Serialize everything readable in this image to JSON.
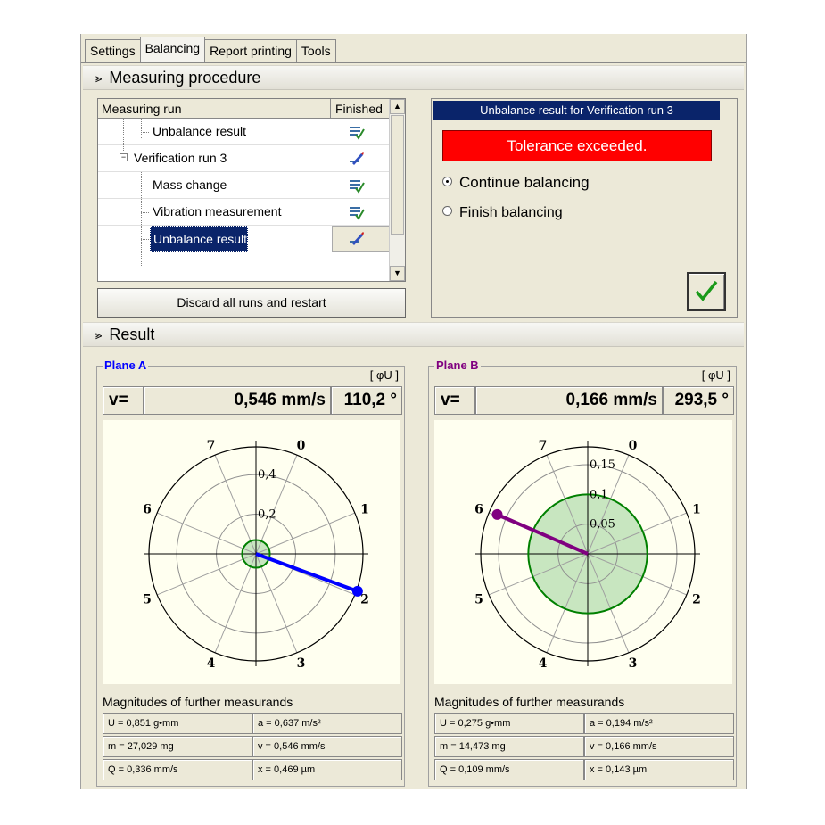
{
  "tabs": [
    {
      "label": "Settings",
      "active": false
    },
    {
      "label": "Balancing",
      "active": true
    },
    {
      "label": "Report printing",
      "active": false
    },
    {
      "label": "Tools",
      "active": false
    }
  ],
  "procedure": {
    "header": "Measuring procedure",
    "columns": {
      "run": "Measuring run",
      "finished": "Finished"
    },
    "rows": [
      {
        "label": "Unbalance result",
        "level": 2,
        "selected": false,
        "icon": "finished-check-icon"
      },
      {
        "label": "Verification run 3",
        "level": 1,
        "selected": false,
        "icon": "current-pen-icon"
      },
      {
        "label": "Mass change",
        "level": 2,
        "selected": false,
        "icon": "finished-check-icon"
      },
      {
        "label": "Vibration measurement",
        "level": 2,
        "selected": false,
        "icon": "finished-check-icon"
      },
      {
        "label": "Unbalance result",
        "level": 2,
        "selected": true,
        "icon": "current-pen-icon"
      }
    ],
    "discard_label": "Discard all runs and restart"
  },
  "unbalance": {
    "title": "Unbalance result for Verification run 3",
    "tolerance": "Tolerance exceeded.",
    "options": [
      {
        "label": "Continue balancing",
        "checked": true
      },
      {
        "label": "Finish balancing",
        "checked": false
      }
    ]
  },
  "result": {
    "header": "Result",
    "planes": [
      {
        "title": "Plane A",
        "title_color": "#0000ff",
        "unit_tag": "[ φU ]",
        "v_label": "v=",
        "v_value": "0,546 mm/s",
        "angle": "110,2 °",
        "polar": {
          "rings": [
            "0,2",
            "0,4"
          ],
          "ring_values": [
            0.2,
            0.4
          ],
          "max_radius_value": 0.54,
          "tolerance_radius": 0.07,
          "vector_magnitude": 0.546,
          "vector_angle_deg": 110.2,
          "vector_color": "#0000ff",
          "sector_labels": [
            "0",
            "1",
            "2",
            "3",
            "4",
            "5",
            "6",
            "7"
          ]
        },
        "magnitudes_title": "Magnitudes of further measurands",
        "magnitudes": [
          [
            "U = 0,851 g•mm",
            "a = 0,637 m/s²"
          ],
          [
            "m = 27,029 mg",
            "v = 0,546 mm/s"
          ],
          [
            "Q = 0,336 mm/s",
            "x = 0,469 µm"
          ]
        ]
      },
      {
        "title": "Plane B",
        "title_color": "#800080",
        "unit_tag": "[ φU ]",
        "v_label": "v=",
        "v_value": "0,166 mm/s",
        "angle": "293,5 °",
        "polar": {
          "rings": [
            "0,05",
            "0,1",
            "0,15"
          ],
          "ring_values": [
            0.05,
            0.1,
            0.15
          ],
          "max_radius_value": 0.18,
          "tolerance_radius": 0.1,
          "vector_magnitude": 0.166,
          "vector_angle_deg": 293.5,
          "vector_color": "#800080",
          "sector_labels": [
            "0",
            "1",
            "2",
            "3",
            "4",
            "5",
            "6",
            "7"
          ]
        },
        "magnitudes_title": "Magnitudes of further measurands",
        "magnitudes": [
          [
            "U = 0,275 g•mm",
            "a = 0,194 m/s²"
          ],
          [
            "m = 14,473 mg",
            "v = 0,166 mm/s"
          ],
          [
            "Q = 0,109 mm/s",
            "x = 0,143 µm"
          ]
        ]
      }
    ]
  }
}
